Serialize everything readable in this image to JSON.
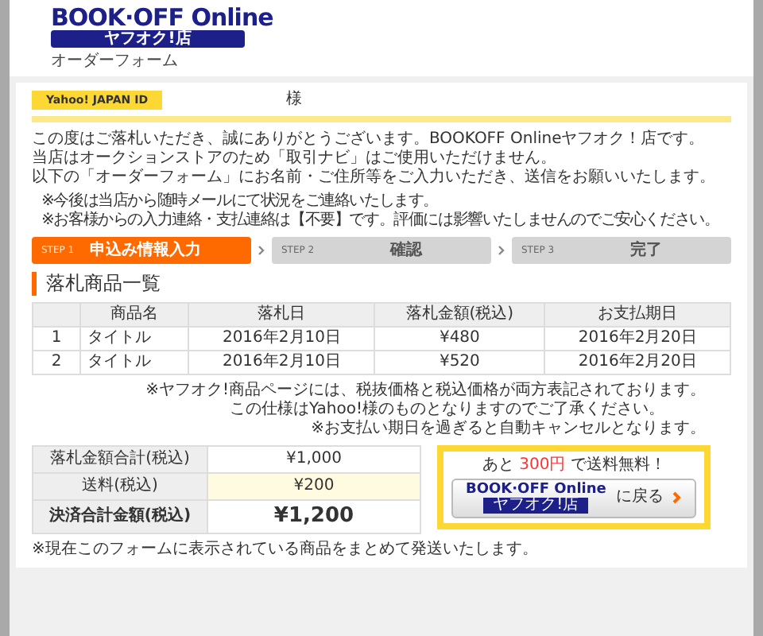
{
  "header": {
    "logo_text": "BOOK·OFF Online",
    "logo_subtext": "ヤフオク!店",
    "page_title": "オーダーフォーム"
  },
  "yahoo_id": {
    "label": "Yahoo! JAPAN ID",
    "suffix": "様"
  },
  "intro": [
    "この度はご落札いただき、誠にありがとうございます。BOOKOFF Onlineヤフオク！店です。",
    "当店はオークションストアのため「取引ナビ」はご使用いただけません。",
    "以下の「オーダーフォーム」にお名前・ご住所等をご入力いただき、送信をお願いいたします。"
  ],
  "notes": [
    "※今後は当店から随時メールにて状況をご連絡いたします。",
    "※お客様からの入力連絡・支払連絡は【不要】です。評価には影響いたしませんのでご安心ください。"
  ],
  "steps": [
    {
      "step": "STEP 1",
      "label": "申込み情報入力",
      "selected": true
    },
    {
      "step": "STEP 2",
      "label": "確認",
      "selected": false
    },
    {
      "step": "STEP 3",
      "label": "完了",
      "selected": false
    }
  ],
  "section_title": "落札商品一覧",
  "table": {
    "columns": [
      "商品名",
      "落札日",
      "落札金額(税込)",
      "お支払期日"
    ],
    "rows": [
      {
        "no": "1",
        "name": "タイトル",
        "date": "2016年2月10日",
        "price": "¥480",
        "due": "2016年2月20日"
      },
      {
        "no": "2",
        "name": "タイトル",
        "date": "2016年2月10日",
        "price": "¥520",
        "due": "2016年2月20日"
      }
    ]
  },
  "table_notes": [
    "※ヤフオク!商品ページには、税抜価格と税込価格が両方表記されております。",
    "この仕様はYahoo!様のものとなりますのでご了承ください。",
    "※お支払い期日を過ぎると自動キャンセルとなります。"
  ],
  "summary": [
    {
      "label": "落札金額合計(税込)",
      "value": "¥1,000",
      "kind": "normal"
    },
    {
      "label": "送料(税込)",
      "value": "¥200",
      "kind": "highlight"
    },
    {
      "label": "決済合計金額(税込)",
      "value": "¥1,200",
      "kind": "total"
    }
  ],
  "promo": {
    "prefix": "あと",
    "amount": "300円",
    "suffix": "で送料無料！",
    "button_logo": "BOOK·OFF Online",
    "button_sublogo": "ヤフオク!店",
    "button_text": "に戻る"
  },
  "footer_note": "※現在このフォームに表示されている商品をまとめて発送いたします。"
}
